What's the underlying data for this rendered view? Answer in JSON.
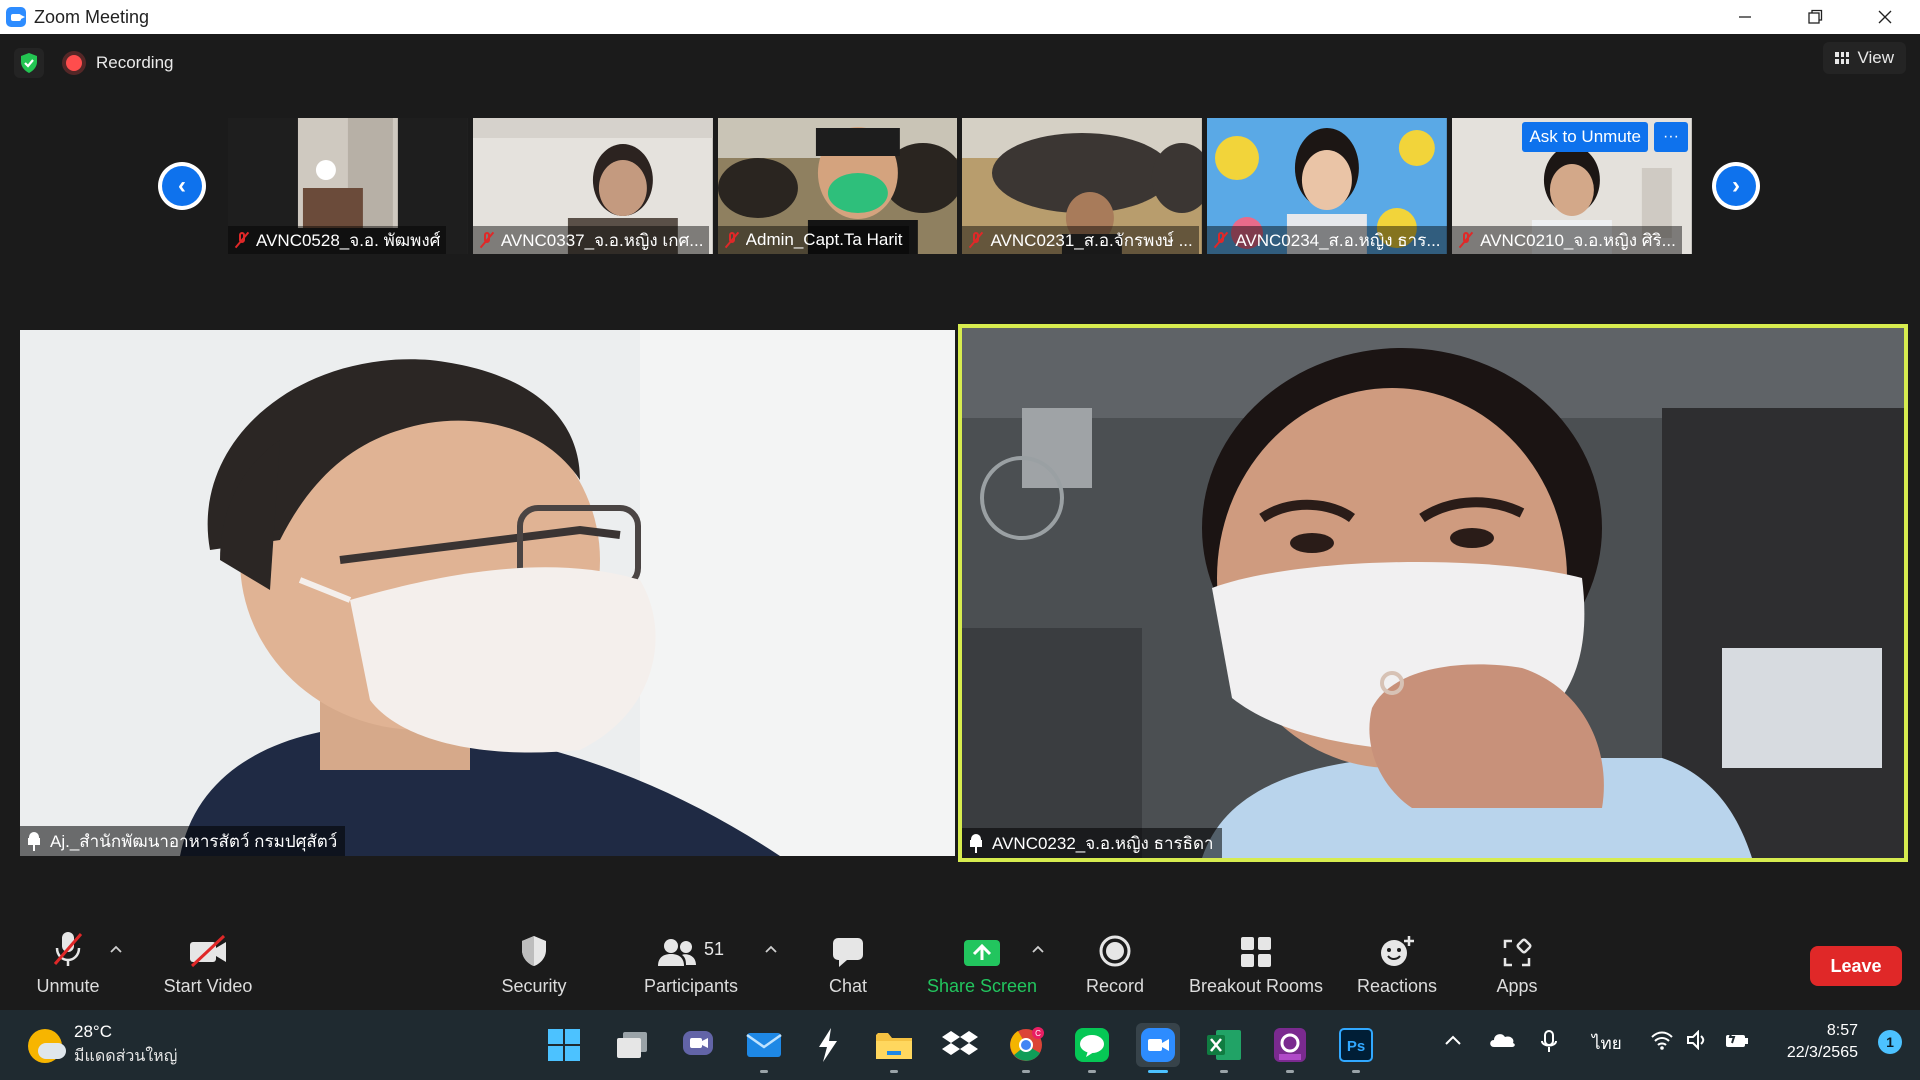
{
  "window": {
    "title": "Zoom Meeting",
    "controls": [
      "minimize-icon",
      "restore-icon",
      "close-icon"
    ]
  },
  "meeting": {
    "recording_label": "Recording",
    "view_label": "View",
    "thumbnails": [
      {
        "name": "AVNC0528_จ.อ. พัฒพงศ์",
        "muted": true
      },
      {
        "name": "AVNC0337_จ.อ.หญิง เกศ...",
        "muted": true
      },
      {
        "name": "Admin_Capt.Ta Harit",
        "muted": true
      },
      {
        "name": "AVNC0231_ส.อ.จักรพงษ์ ...",
        "muted": true
      },
      {
        "name": "AVNC0234_ส.อ.หญิง ธาร...",
        "muted": true
      },
      {
        "name": "AVNC0210_จ.อ.หญิง ศิริ...",
        "muted": true
      }
    ],
    "ask_unmute_label": "Ask to Unmute",
    "more_label": "···",
    "main_videos": [
      {
        "name": "Aj._สำนักพัฒนาอาหารสัตว์ กรมปศุสัตว์"
      },
      {
        "name": "AVNC0232_จ.อ.หญิง ธารธิดา",
        "active_speaker": true
      }
    ]
  },
  "toolbar": {
    "unmute": "Unmute",
    "start_video": "Start Video",
    "security": "Security",
    "participants": "Participants",
    "participants_count": "51",
    "chat": "Chat",
    "share_screen": "Share Screen",
    "record": "Record",
    "breakout_rooms": "Breakout Rooms",
    "reactions": "Reactions",
    "apps": "Apps",
    "leave": "Leave"
  },
  "taskbar": {
    "weather_temp": "28°C",
    "weather_desc": "มีแดดส่วนใหญ่",
    "language": "ไทย",
    "time": "8:57",
    "date": "22/3/2565",
    "notification_count": "1",
    "chrome_badge": "C"
  },
  "colors": {
    "zoom_blue": "#0e72ed",
    "active_speaker_border": "#d7ec4f",
    "leave_red": "#e02828",
    "share_green": "#22c55e"
  }
}
